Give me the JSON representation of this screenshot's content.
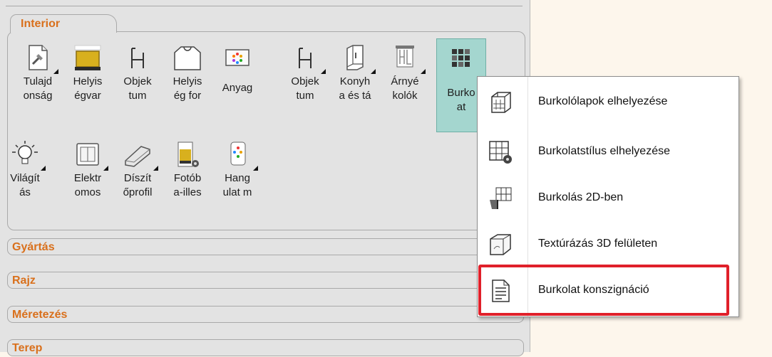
{
  "panel": {
    "tab": "Interior",
    "tools_row1": [
      {
        "label": "Tulajd\nonság",
        "icon": "properties-icon"
      },
      {
        "label": "Helyis\négvar",
        "icon": "room-wall-icon"
      },
      {
        "label": "Objek\ntum",
        "icon": "chair-object-icon"
      },
      {
        "label": "Helyis\nég for",
        "icon": "room-shape-icon"
      },
      {
        "label": "Anyag",
        "icon": "material-icon"
      },
      {
        "label": "Objek\ntum",
        "icon": "chair-object-icon"
      },
      {
        "label": "Konyh\na és tá",
        "icon": "kitchen-cabinet-icon"
      },
      {
        "label": "Árnyé\nkolók",
        "icon": "window-shade-icon"
      },
      {
        "label": "Burko\nat",
        "icon": "tile-grid-icon"
      }
    ],
    "tools_row2": [
      {
        "label": "Világít\nás",
        "icon": "light-bulb-icon"
      },
      {
        "label": "Elektr\nomos",
        "icon": "electric-switch-icon"
      },
      {
        "label": "Díszít\nőprofil",
        "icon": "molding-profile-icon"
      },
      {
        "label": "Fotób\na-illes",
        "icon": "photo-fit-icon"
      },
      {
        "label": "Hang\nulat m",
        "icon": "mood-icon"
      }
    ],
    "sections": [
      "Gyártás",
      "Rajz",
      "Méretezés",
      "Terep"
    ]
  },
  "menu": {
    "items": [
      {
        "label": "Burkolólapok elhelyezése",
        "icon": "tile-cube-icon"
      },
      {
        "label": "Burkolatstílus elhelyezése",
        "icon": "tile-style-gear-icon"
      },
      {
        "label": "Burkolás 2D-ben",
        "icon": "tile-2d-icon"
      },
      {
        "label": "Textúrázás 3D felületen",
        "icon": "texture-3d-icon"
      },
      {
        "label": "Burkolat konszignáció",
        "icon": "document-list-icon"
      }
    ],
    "highlight_color": "#e0202a"
  },
  "colors": {
    "section_text": "#d9701c",
    "active_tool_bg": "#a4d6cf",
    "background": "#fdf6ec"
  }
}
